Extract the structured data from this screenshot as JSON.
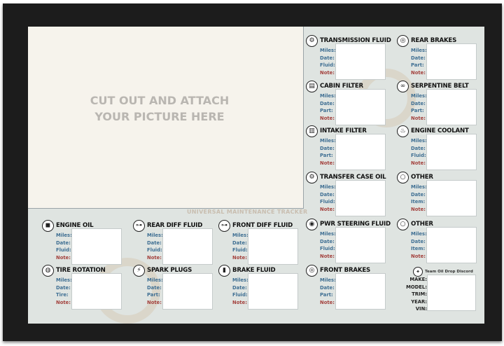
{
  "photo": {
    "line1": "CUT OUT AND ATTACH",
    "line2": "YOUR PICTURE HERE"
  },
  "tracker_title": "UNIVERSAL MAINTENANCE TRACKER",
  "cards": [
    {
      "title": "TRANSMISSION FLUID",
      "icon": "transmission-icon",
      "fields": [
        "Miles:",
        "Date:",
        "Fluid:",
        "Note:"
      ]
    },
    {
      "title": "REAR BRAKES",
      "icon": "brake-disc-icon",
      "fields": [
        "Miles:",
        "Date:",
        "Part:",
        "Note:"
      ]
    },
    {
      "title": "CABIN FILTER",
      "icon": "cabin-filter-icon",
      "fields": [
        "Miles:",
        "Date:",
        "Part:",
        "Note:"
      ]
    },
    {
      "title": "SERPENTINE BELT",
      "icon": "belt-icon",
      "fields": [
        "Miles:",
        "Date:",
        "Part:",
        "Note:"
      ]
    },
    {
      "title": "INTAKE FILTER",
      "icon": "air-filter-icon",
      "fields": [
        "Miles:",
        "Date:",
        "Part:",
        "Note:"
      ]
    },
    {
      "title": "ENGINE COOLANT",
      "icon": "coolant-icon",
      "fields": [
        "Miles:",
        "Date:",
        "Fluid:",
        "Note:"
      ]
    },
    {
      "title": "TRANSFER CASE OIL",
      "icon": "transfer-case-icon",
      "fields": [
        "Miles:",
        "Date:",
        "Fluid:",
        "Note:"
      ]
    },
    {
      "title": "OTHER",
      "icon": "ring-icon",
      "fields": [
        "Miles:",
        "Date:",
        "Item:",
        "Note:"
      ]
    },
    {
      "title": "PWR STEERING FLUID",
      "icon": "steering-wheel-icon",
      "fields": [
        "Miles:",
        "Date:",
        "Fluid:",
        "Note:"
      ]
    },
    {
      "title": "OTHER",
      "icon": "ring-icon",
      "fields": [
        "Miles:",
        "Date:",
        "Item:",
        "Note:"
      ]
    },
    {
      "title": "FRONT BRAKES",
      "icon": "brake-disc-icon",
      "fields": [
        "Miles:",
        "Date:",
        "Part:",
        "Note:"
      ]
    },
    {
      "title": "ENGINE OIL",
      "icon": "oil-filter-icon",
      "fields": [
        "Miles:",
        "Date:",
        "Fluid:",
        "Note:"
      ]
    },
    {
      "title": "REAR DIFF FLUID",
      "icon": "axle-icon",
      "fields": [
        "Miles:",
        "Date:",
        "Fluid:",
        "Note:"
      ]
    },
    {
      "title": "FRONT DIFF FLUID",
      "icon": "axle-icon",
      "fields": [
        "Miles:",
        "Date:",
        "Fluid:",
        "Note:"
      ]
    },
    {
      "title": "TIRE ROTATION",
      "icon": "tire-icon",
      "fields": [
        "Miles:",
        "Date:",
        "Tire:",
        "Note:"
      ]
    },
    {
      "title": "SPARK PLUGS",
      "icon": "spark-plug-icon",
      "fields": [
        "Miles:",
        "Date:",
        "Part:",
        "Note:"
      ]
    },
    {
      "title": "BRAKE FLUID",
      "icon": "brake-fluid-icon",
      "fields": [
        "Miles:",
        "Date:",
        "Fluid:",
        "Note:"
      ]
    }
  ],
  "vehicle": {
    "brand": "Team Oil Drop Discord",
    "fields": [
      "MAKE:",
      "MODEL:",
      "TRIM:",
      "YEAR:",
      "VIN:"
    ]
  },
  "colors": {
    "frame": "#1c1c1c",
    "board": "#dfe4e1",
    "photo_area": "#f6f3ec",
    "label_blue": "#3f6f93",
    "label_note": "#a3413d"
  }
}
